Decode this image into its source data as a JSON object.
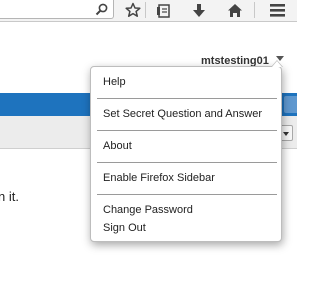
{
  "user": {
    "name": "mtstesting01"
  },
  "menu": {
    "items": [
      {
        "label": "Help"
      },
      {
        "label": "Set Secret Question and Answer"
      },
      {
        "label": "About"
      },
      {
        "label": "Enable Firefox Sidebar"
      },
      {
        "label": "Change Password"
      },
      {
        "label": "Sign Out"
      }
    ]
  },
  "page": {
    "body_text_fragment": "n it."
  },
  "colors": {
    "accent": "#1e73be",
    "toolbar": "#f3f3f3",
    "band": "#ececec"
  },
  "toolbar_icons": [
    "search-icon",
    "bookmark-star-icon",
    "reading-list-icon",
    "download-icon",
    "home-icon",
    "hamburger-menu-icon"
  ]
}
